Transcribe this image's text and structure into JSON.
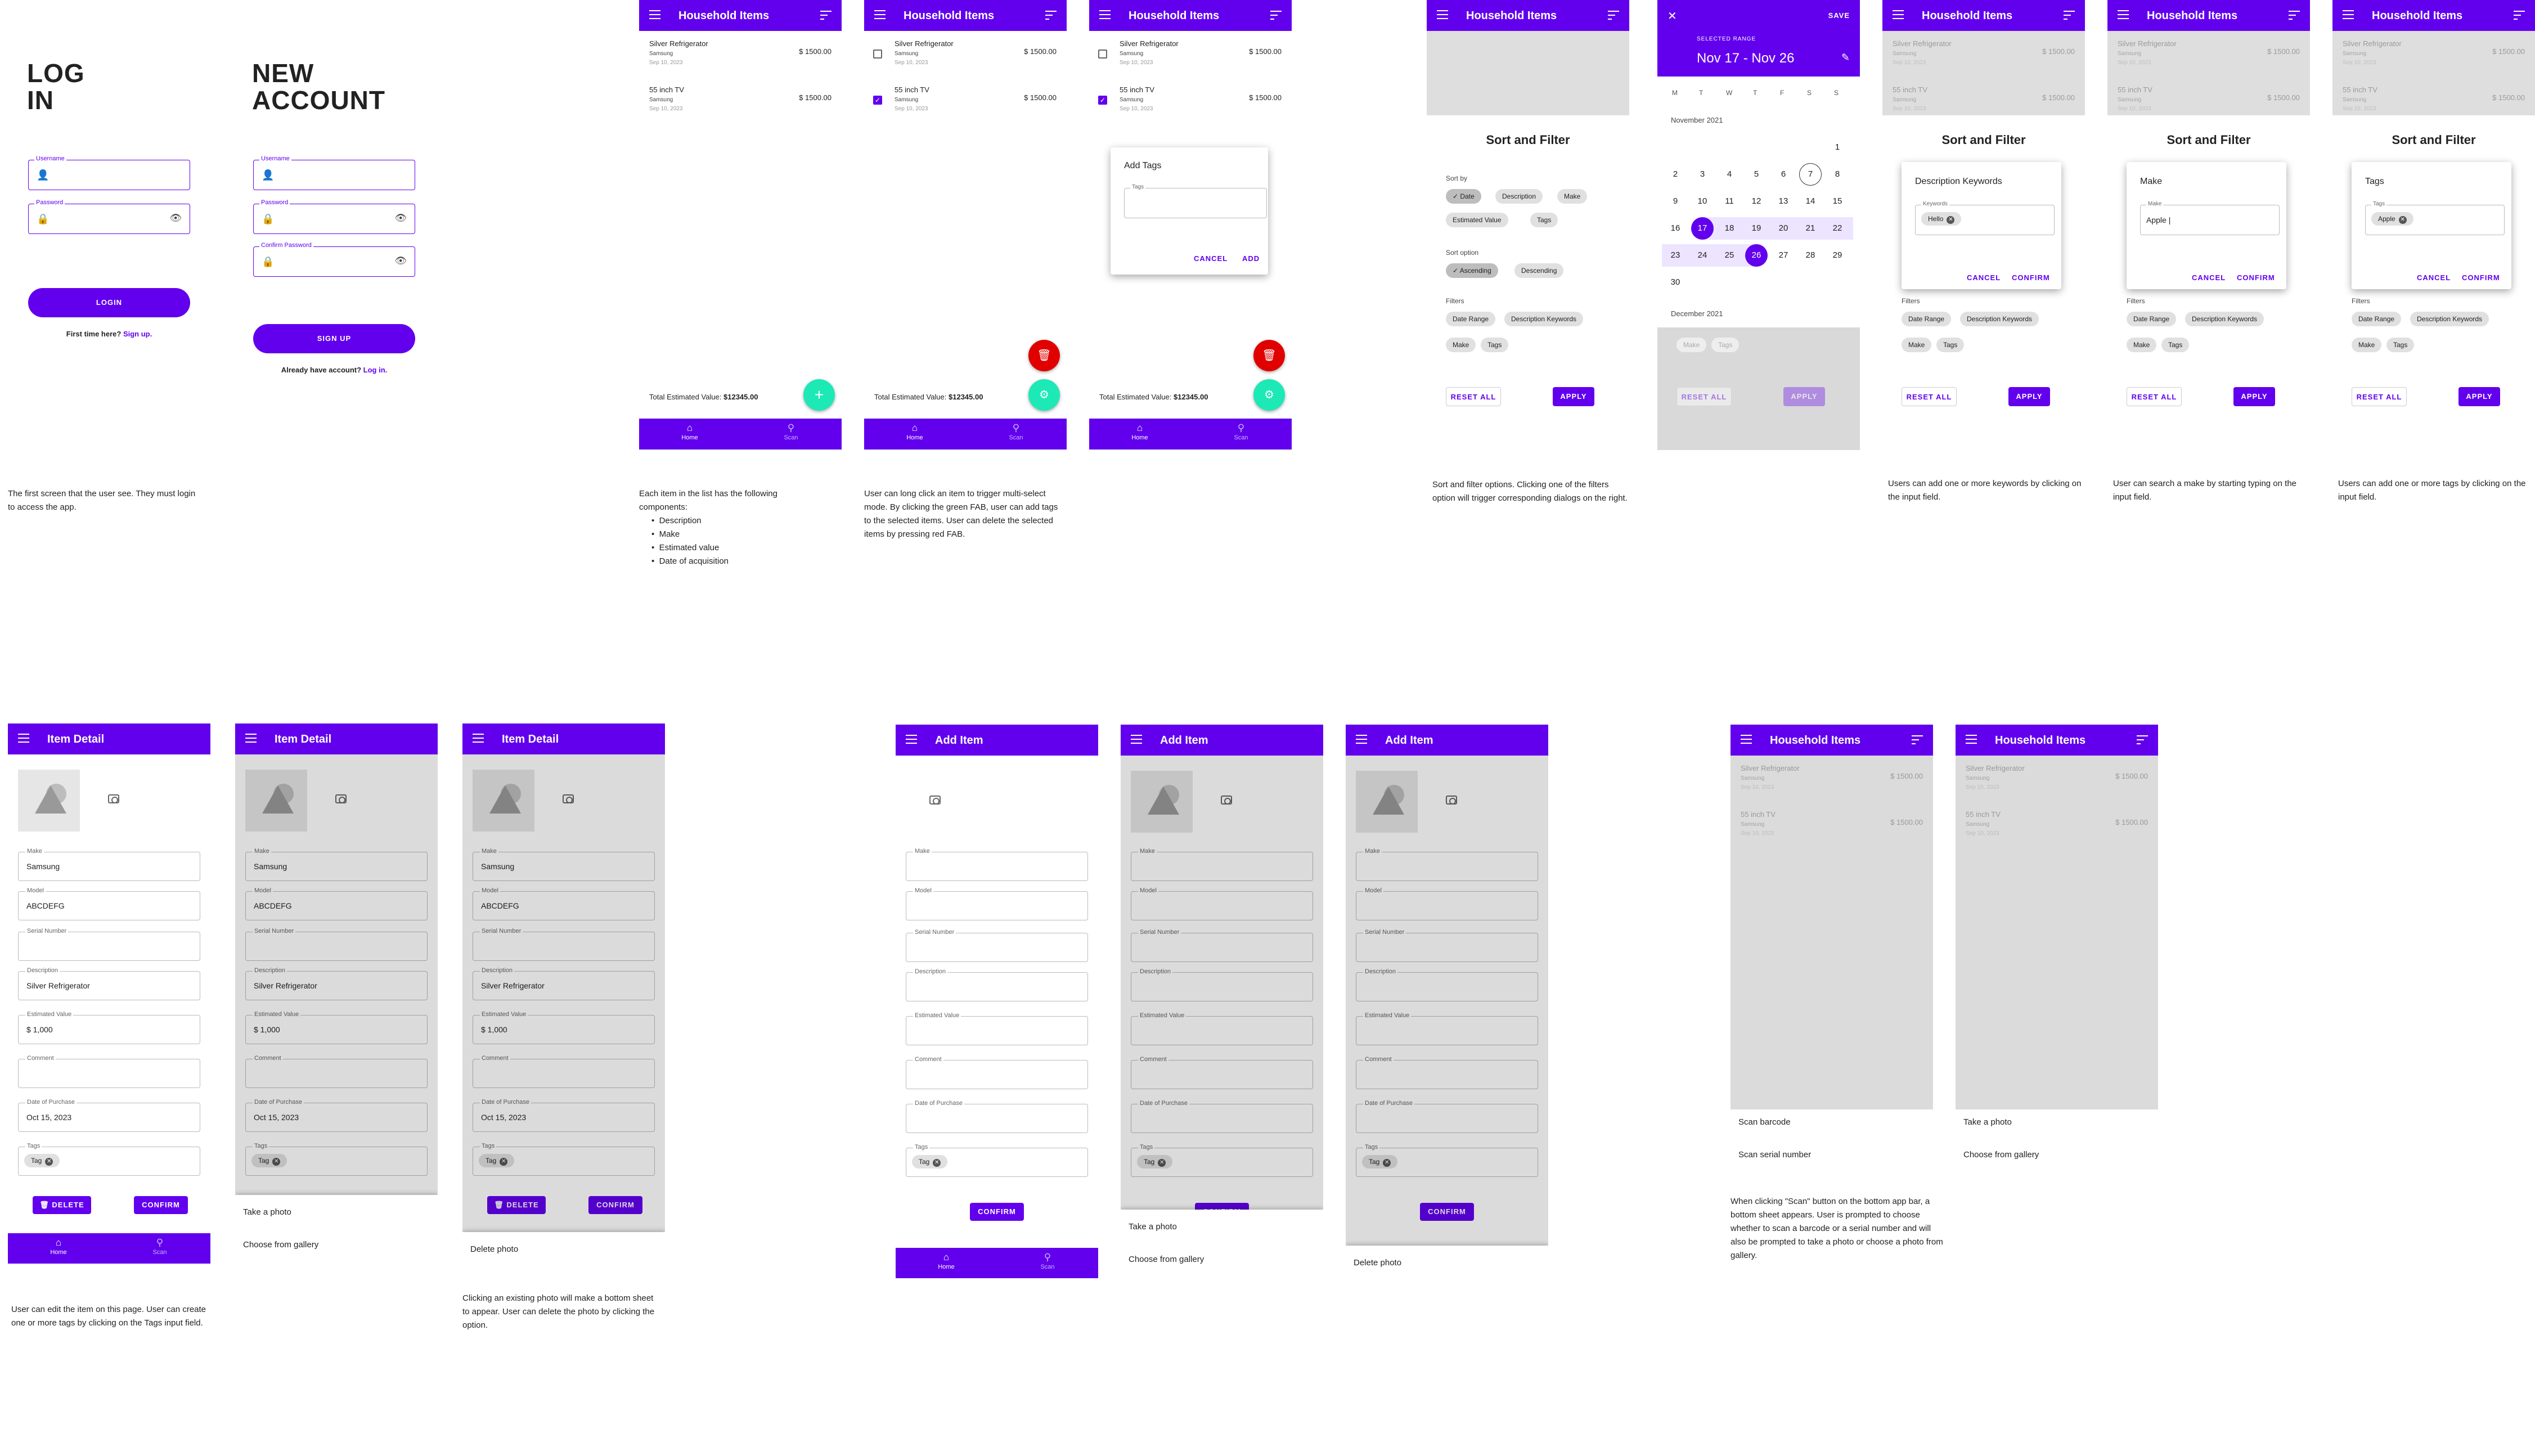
{
  "login": {
    "title_line1": "LOG",
    "title_line2": "IN",
    "username_label": "Username",
    "password_label": "Password",
    "button": "LOGIN",
    "footer_prefix": "First time here?",
    "footer_link": "Sign up.",
    "caption": "The first screen that the user see. They must login to access the app."
  },
  "signup": {
    "title_line1": "NEW",
    "title_line2": "ACCOUNT",
    "username_label": "Username",
    "password_label": "Password",
    "confirm_label": "Confirm Password",
    "button": "SIGN UP",
    "footer_prefix": "Already have account?",
    "footer_link": "Log in."
  },
  "household": {
    "title": "Household Items",
    "items": [
      {
        "desc": "Silver Refrigerator",
        "make": "Samsung",
        "date": "Sep 10, 2023",
        "value": "$ 1500.00"
      },
      {
        "desc": "55 inch TV",
        "make": "Samsung",
        "date": "Sep 10, 2023",
        "value": "$ 1500.00"
      }
    ],
    "total_label": "Total Estimated Value:",
    "total_value": "$12345.00",
    "nav": {
      "home": "Home",
      "scan": "Scan"
    },
    "caption_intro": "Each item in the list has the following components:",
    "caption_bullets": [
      "Description",
      "Make",
      "Estimated value",
      "Date of acquisition"
    ],
    "caption_multiselect": "User can long click an item to trigger multi-select mode. By clicking the green FAB, user can add tags to the selected items. User can delete the selected items by pressing red FAB."
  },
  "add_tags_dialog": {
    "title": "Add Tags",
    "field_label": "Tags",
    "cancel": "CANCEL",
    "add": "ADD"
  },
  "sort_filter": {
    "title": "Sort and Filter",
    "sort_by_label": "Sort by",
    "sort_by": [
      "Date",
      "Description",
      "Make",
      "Estimated Value",
      "Tags"
    ],
    "sort_option_label": "Sort option",
    "sort_options": [
      "Ascending",
      "Descending"
    ],
    "filters_label": "Filters",
    "filters": [
      "Date Range",
      "Description Keywords",
      "Make",
      "Tags"
    ],
    "reset": "RESET ALL",
    "apply": "APPLY",
    "caption": "Sort and filter options. Clicking one of the filters option will trigger corresponding dialogs on the right."
  },
  "date_picker": {
    "save": "SAVE",
    "selected_range_label": "SELECTED RANGE",
    "range": "Nov 17 - Nov 26",
    "weekdays": [
      "M",
      "T",
      "W",
      "T",
      "F",
      "S",
      "S"
    ],
    "month1": "November 2021",
    "month2": "December 2021",
    "day_rows": [
      [
        "",
        "",
        "",
        "",
        "",
        "",
        "1"
      ],
      [
        "2",
        "3",
        "4",
        "5",
        "6",
        "7",
        "8"
      ],
      [
        "9",
        "10",
        "11",
        "12",
        "13",
        "14",
        "15"
      ],
      [
        "16",
        "17",
        "18",
        "19",
        "20",
        "21",
        "22"
      ],
      [
        "23",
        "24",
        "25",
        "26",
        "27",
        "28",
        "29"
      ],
      [
        "30",
        "",
        "",
        "",
        "",
        "",
        ""
      ]
    ]
  },
  "keywords_dialog": {
    "title": "Description Keywords",
    "field_label": "Keywords",
    "chip": "Hello",
    "cancel": "CANCEL",
    "confirm": "CONFIRM",
    "caption": "Users can add one or more keywords by clicking on the input field."
  },
  "make_dialog": {
    "title": "Make",
    "field_label": "Make",
    "value": "Apple |",
    "cancel": "CANCEL",
    "confirm": "CONFIRM",
    "caption": "User can search a make by starting typing on the input field."
  },
  "tags_dialog": {
    "title": "Tags",
    "field_label": "Tags",
    "chip": "Apple",
    "cancel": "CANCEL",
    "confirm": "CONFIRM",
    "caption": "Users can add one or more tags by clicking on the input field."
  },
  "item_detail": {
    "title": "Item Detail",
    "fields": [
      {
        "label": "Make",
        "value": "Samsung"
      },
      {
        "label": "Model",
        "value": "ABCDEFG"
      },
      {
        "label": "Serial Number",
        "value": ""
      },
      {
        "label": "Description",
        "value": "Silver Refrigerator"
      },
      {
        "label": "Estimated Value",
        "value": "$ 1,000"
      },
      {
        "label": "Comment",
        "value": ""
      },
      {
        "label": "Date of Purchase",
        "value": "Oct 15, 2023"
      }
    ],
    "tags_label": "Tags",
    "tag_chip": "Tag",
    "delete": "DELETE",
    "confirm": "CONFIRM",
    "caption": "User can edit the item on this page. User can create one or more tags by clicking on the Tags input field.",
    "sheet_take": "Take a photo",
    "sheet_gallery": "Choose from gallery",
    "sheet_delete": "Delete photo",
    "caption_photo": "Clicking an existing photo will make a bottom sheet to appear. User can delete the photo by clicking the option."
  },
  "add_item": {
    "title": "Add Item",
    "fields": [
      "Make",
      "Model",
      "Serial Number",
      "Description",
      "Estimated Value",
      "Comment",
      "Date of Purchase"
    ],
    "tags_label": "Tags",
    "tag_chip": "Tag",
    "confirm": "CONFIRM",
    "sheet_take": "Take a photo",
    "sheet_gallery": "Choose from gallery",
    "sheet_delete": "Delete photo"
  },
  "scan": {
    "barcode": "Scan barcode",
    "serial": "Scan serial number",
    "take": "Take a photo",
    "gallery": "Choose from gallery",
    "caption": "When clicking \"Scan\" button on the bottom app bar, a bottom sheet appears. User is prompted to choose whether to scan a barcode or a serial number and will also be prompted to take a photo or choose a photo from gallery."
  },
  "colors": {
    "primary": "#6200ee",
    "fab_green": "#1de9b6",
    "fab_red": "#e00000"
  }
}
